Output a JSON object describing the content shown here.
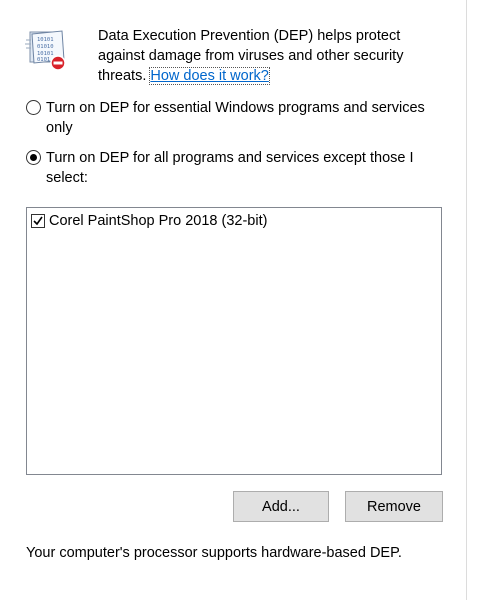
{
  "intro": {
    "text": "Data Execution Prevention (DEP) helps protect against damage from viruses and other security threats.",
    "link": "How does it work?"
  },
  "options": [
    {
      "label": "Turn on DEP for essential Windows programs and services only",
      "checked": false
    },
    {
      "label": "Turn on DEP for all programs and services except those I select:",
      "checked": true
    }
  ],
  "exceptions_list": {
    "items": [
      {
        "label": "Corel PaintShop Pro 2018 (32-bit)",
        "checked": true
      }
    ]
  },
  "buttons": {
    "add_label": "Add...",
    "remove_label": "Remove"
  },
  "status_text": "Your computer's processor supports hardware-based DEP.",
  "colors": {
    "link": "#0066cc",
    "button_bg": "#e1e1e1",
    "list_border": "#828790"
  },
  "icons": {
    "dep": "dep-binary-shield-icon"
  }
}
